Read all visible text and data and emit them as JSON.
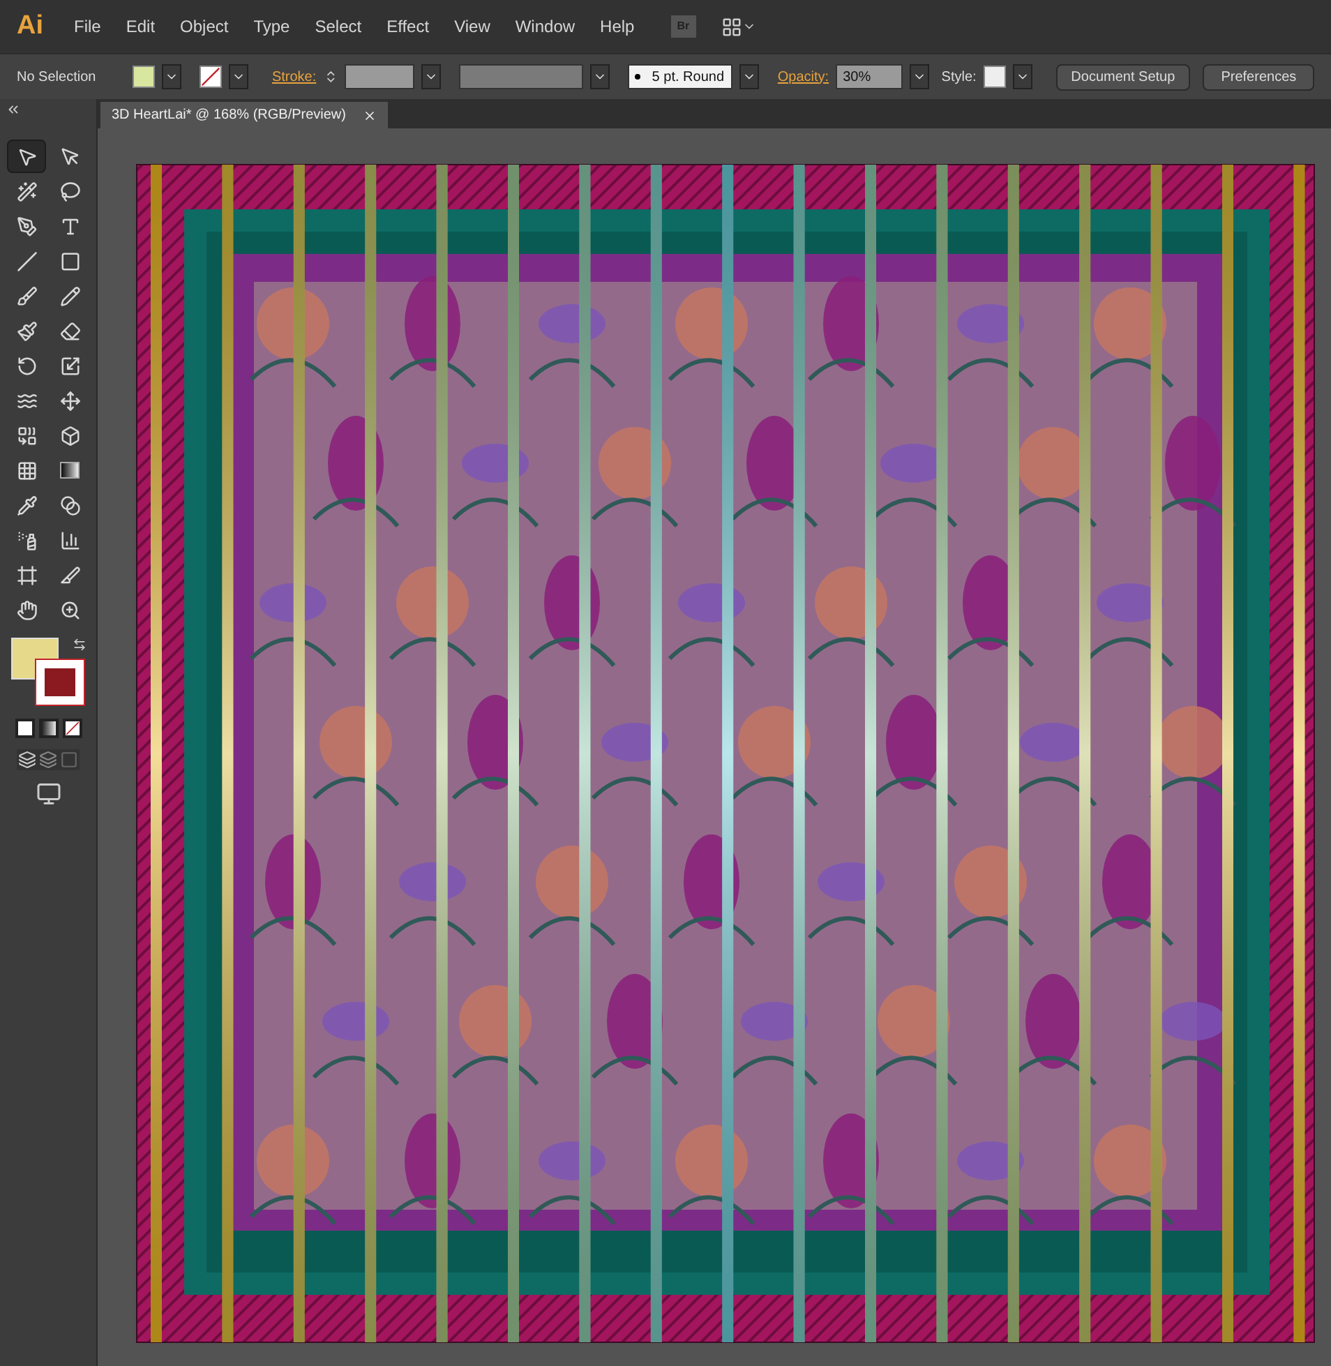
{
  "app": {
    "logo": "Ai",
    "bridge_label": "Br"
  },
  "menu": [
    "File",
    "Edit",
    "Object",
    "Type",
    "Select",
    "Effect",
    "View",
    "Window",
    "Help"
  ],
  "control_bar": {
    "selection": "No Selection",
    "stroke_label": "Stroke:",
    "brush": "5 pt. Round",
    "opacity_label": "Opacity:",
    "opacity": "30%",
    "style_label": "Style:",
    "buttons": [
      "Document Setup",
      "Preferences"
    ]
  },
  "document_tabs": [
    {
      "title": "3D HeartLai* @ 168% (RGB/Preview)",
      "selected": true
    }
  ],
  "tools": [
    {
      "kind": "selection",
      "selected": true
    },
    {
      "kind": "direct",
      "selected": false
    },
    {
      "kind": "wand",
      "selected": false
    },
    {
      "kind": "lasso",
      "selected": false
    },
    {
      "kind": "pen",
      "selected": false
    },
    {
      "kind": "type",
      "selected": false
    },
    {
      "kind": "line",
      "selected": false
    },
    {
      "kind": "rectangle",
      "selected": false
    },
    {
      "kind": "brush",
      "selected": false
    },
    {
      "kind": "pencil",
      "selected": false
    },
    {
      "kind": "blob",
      "selected": false
    },
    {
      "kind": "eraser",
      "selected": false
    },
    {
      "kind": "rotate",
      "selected": false
    },
    {
      "kind": "scale",
      "selected": false
    },
    {
      "kind": "warp",
      "selected": false
    },
    {
      "kind": "transform",
      "selected": false
    },
    {
      "kind": "builder",
      "selected": false
    },
    {
      "kind": "perspective",
      "selected": false
    },
    {
      "kind": "mesh",
      "selected": false
    },
    {
      "kind": "gradient",
      "selected": false
    },
    {
      "kind": "eyedropper",
      "selected": false
    },
    {
      "kind": "blend",
      "selected": false
    },
    {
      "kind": "sprayer",
      "selected": false
    },
    {
      "kind": "graph",
      "selected": false
    },
    {
      "kind": "artboard",
      "selected": false
    },
    {
      "kind": "slice",
      "selected": false
    },
    {
      "kind": "hand",
      "selected": false
    },
    {
      "kind": "zoom",
      "selected": false
    }
  ]
}
